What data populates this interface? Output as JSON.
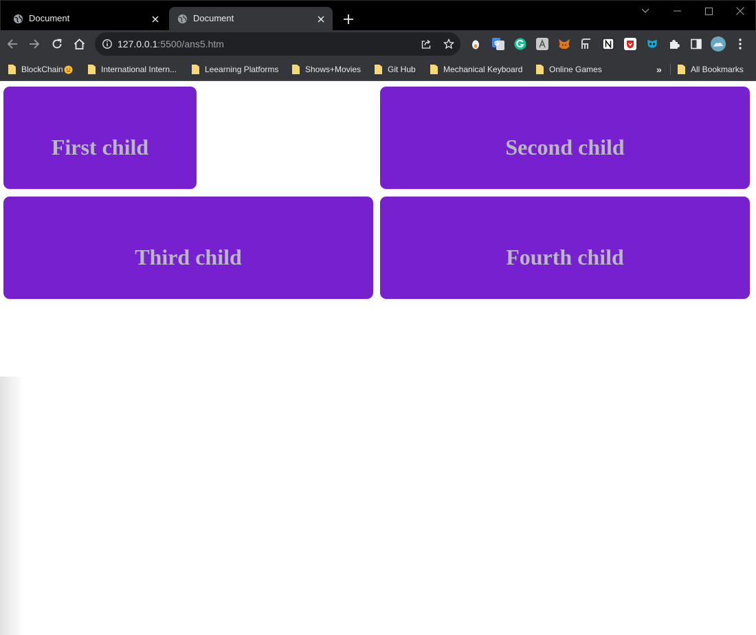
{
  "browser": {
    "tabs": [
      {
        "title": "Document",
        "active": false
      },
      {
        "title": "Document",
        "active": true
      }
    ],
    "address": {
      "host": "127.0.0.1",
      "path": ":5500/ans5.htm"
    },
    "bookmarks": [
      {
        "label": "BlockChain"
      },
      {
        "label": "International Intern..."
      },
      {
        "label": "Leearning Platforms"
      },
      {
        "label": "Shows+Movies"
      },
      {
        "label": "Git Hub"
      },
      {
        "label": "Mechanical Keyboard"
      },
      {
        "label": "Online Games"
      }
    ],
    "bookmarks_overflow": "»",
    "all_bookmarks": "All Bookmarks",
    "icons": {
      "tab_favicon": "globe-icon",
      "back": "back-arrow-icon",
      "forward": "forward-arrow-icon",
      "reload": "reload-icon",
      "home": "home-icon",
      "site_info": "info-icon",
      "share": "share-icon",
      "star": "star-icon",
      "extensions": "puzzle-icon",
      "side_panel": "side-panel-icon",
      "menu": "kebab-menu-icon"
    },
    "colors": {
      "tabstrip": "#000000",
      "toolbar": "#35363a",
      "omnibox": "#202124",
      "folder": "#f8d775"
    }
  },
  "content": {
    "boxes": [
      {
        "label": "First child"
      },
      {
        "label": "Second child"
      },
      {
        "label": "Third child"
      },
      {
        "label": "Fourth child"
      }
    ],
    "colors": {
      "box_background": "#7720d0",
      "box_text": "#b8b8c0",
      "page_background": "#ffffff"
    }
  }
}
